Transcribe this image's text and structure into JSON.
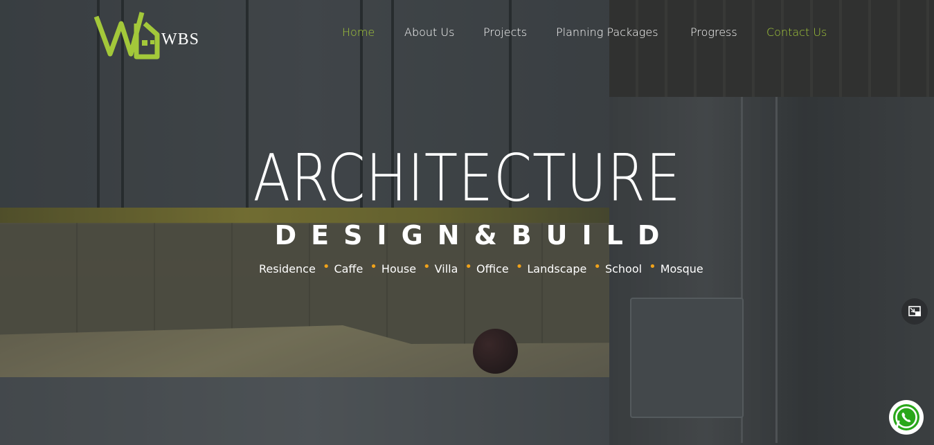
{
  "brand": {
    "name": "WBS",
    "accent_color": "#a3c83a"
  },
  "nav": {
    "items": [
      {
        "label": "Home",
        "active": true
      },
      {
        "label": "About Us",
        "active": false
      },
      {
        "label": "Projects",
        "active": false
      },
      {
        "label": "Planning Packages",
        "active": false
      },
      {
        "label": "Progress",
        "active": false
      },
      {
        "label": "Contact Us",
        "active": false
      }
    ]
  },
  "hero": {
    "title": "ARCHITECTURE",
    "subtitle": "DESIGN&BUILD",
    "tags": [
      "Residence",
      "Caffe",
      "House",
      "Villa",
      "Office",
      "Landscape",
      "School",
      "Mosque"
    ],
    "bullet_color": "#f0a21a"
  },
  "icons": {
    "pip": "picture-in-picture-icon",
    "chat": "whatsapp-icon"
  }
}
